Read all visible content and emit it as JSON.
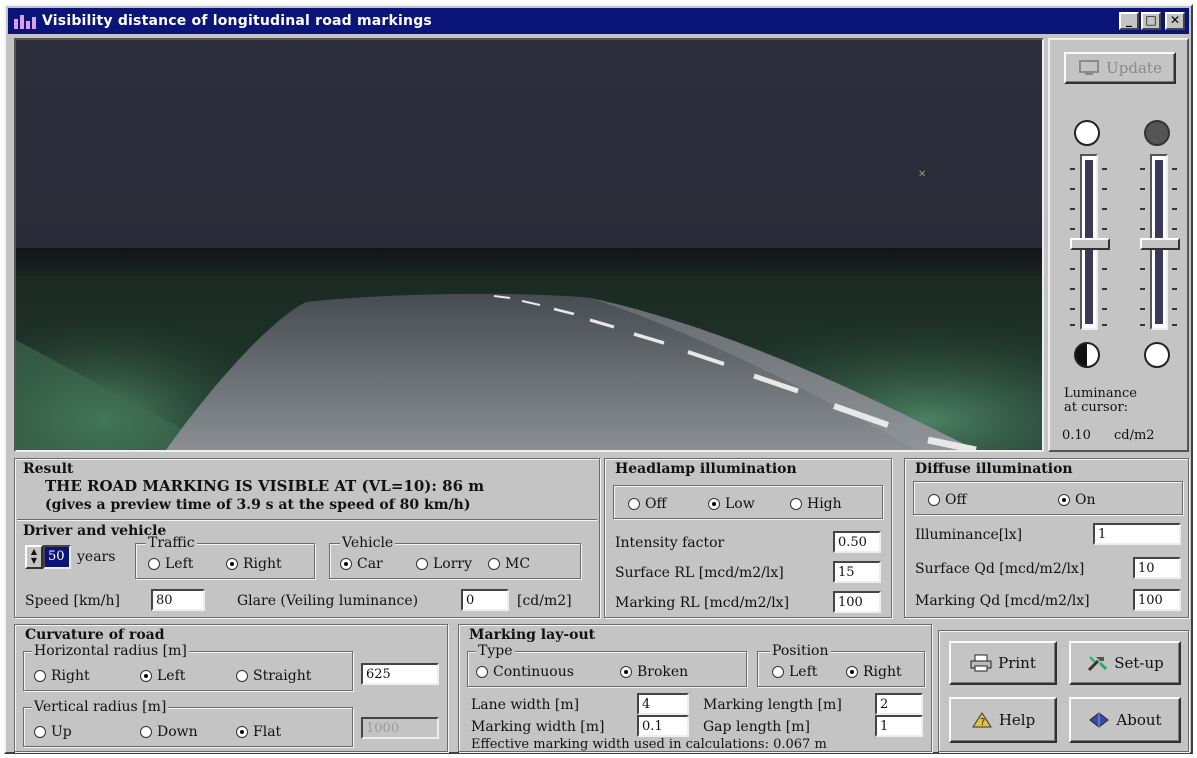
{
  "window": {
    "title": "Visibility distance of longitudinal road markings"
  },
  "side": {
    "update_label": "Update",
    "luminance_label_line1": "Luminance",
    "luminance_label_line2": "at cursor:",
    "luminance_value": "0.10",
    "luminance_unit": "cd/m2"
  },
  "result": {
    "title": "Result",
    "line1": "THE ROAD MARKING IS VISIBLE AT (VL=10):  86  m",
    "line2": "(gives a preview time of 3.9 s at the speed of 80  km/h)"
  },
  "driver": {
    "title": "Driver and vehicle",
    "age_value": "50",
    "years_label": "years",
    "traffic_label": "Traffic",
    "traffic_left": "Left",
    "traffic_right": "Right",
    "traffic_selected": "Right",
    "vehicle_label": "Vehicle",
    "vehicle_car": "Car",
    "vehicle_lorry": "Lorry",
    "vehicle_mc": "MC",
    "vehicle_selected": "Car",
    "speed_label": "Speed [km/h]",
    "speed_value": "80",
    "glare_label": "Glare (Veiling luminance)",
    "glare_value": "0",
    "glare_unit": "[cd/m2]"
  },
  "headlamp": {
    "title": "Headlamp illumination",
    "off": "Off",
    "low": "Low",
    "high": "High",
    "selected": "Low",
    "intensity_label": "Intensity factor",
    "intensity_value": "0.50",
    "surface_rl_label": "Surface RL [mcd/m2/lx]",
    "surface_rl_value": "15",
    "marking_rl_label": "Marking RL [mcd/m2/lx]",
    "marking_rl_value": "100"
  },
  "diffuse": {
    "title": "Diffuse illumination",
    "off": "Off",
    "on": "On",
    "selected": "On",
    "illuminance_label": "Illuminance[lx]",
    "illuminance_value": "1",
    "surface_qd_label": "Surface Qd [mcd/m2/lx]",
    "surface_qd_value": "10",
    "marking_qd_label": "Marking Qd [mcd/m2/lx]",
    "marking_qd_value": "100"
  },
  "curvature": {
    "title": "Curvature of road",
    "horizontal_label": "Horizontal radius [m]",
    "h_right": "Right",
    "h_left": "Left",
    "h_straight": "Straight",
    "h_selected": "Left",
    "h_value": "625",
    "vertical_label": "Vertical radius [m]",
    "v_up": "Up",
    "v_down": "Down",
    "v_flat": "Flat",
    "v_selected": "Flat",
    "v_value": "1000"
  },
  "marking": {
    "title": "Marking lay-out",
    "type_label": "Type",
    "type_continuous": "Continuous",
    "type_broken": "Broken",
    "type_selected": "Broken",
    "position_label": "Position",
    "pos_left": "Left",
    "pos_right": "Right",
    "pos_selected": "Right",
    "lane_width_label": "Lane width [m]",
    "lane_width_value": "4",
    "marking_length_label": "Marking length [m]",
    "marking_length_value": "2",
    "marking_width_label": "Marking width [m]",
    "marking_width_value": "0.1",
    "gap_length_label": "Gap length [m]",
    "gap_length_value": "1",
    "effective_note": "Effective marking width used in calculations: 0.067 m"
  },
  "buttons": {
    "print": "Print",
    "setup": "Set-up",
    "help": "Help",
    "about": "About"
  },
  "icons": {
    "update": "monitor-icon",
    "print": "printer-icon",
    "setup": "tools-icon",
    "help": "help-icon",
    "about": "diamond-icon"
  }
}
